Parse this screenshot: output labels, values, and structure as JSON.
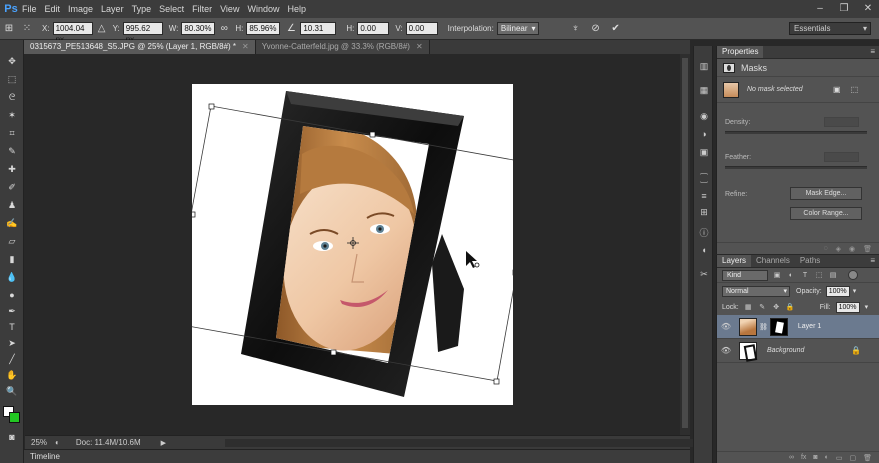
{
  "app": {
    "logo": "Ps"
  },
  "menu": [
    "File",
    "Edit",
    "Image",
    "Layer",
    "Type",
    "Select",
    "Filter",
    "View",
    "Window",
    "Help"
  ],
  "window_controls": {
    "minimize": "–",
    "restore": "❐",
    "close": "✕"
  },
  "options": {
    "x_label": "X:",
    "x_value": "1004.04 px",
    "y_label": "Y:",
    "y_value": "995.62 px",
    "w_label": "W:",
    "w_value": "80.30%",
    "h_label": "H:",
    "h_value": "85.96%",
    "angle_value": "10.31",
    "hskew_label": "H:",
    "hskew_value": "0.00",
    "vskew_label": "V:",
    "vskew_value": "0.00",
    "interp_label": "Interpolation:",
    "interp_value": "Bilinear",
    "workspace": "Essentials"
  },
  "tabs": [
    {
      "label": "0315673_PE513648_S5.JPG @ 25% (Layer 1, RGB/8#) *",
      "active": true
    },
    {
      "label": "Yvonne-Catterfeld.jpg @ 33.3% (RGB/8#)",
      "active": false
    }
  ],
  "status": {
    "zoom": "25%",
    "doc_info": "Doc: 11.4M/10.6M",
    "arrow": "▶"
  },
  "timeline": {
    "label": "Timeline"
  },
  "properties": {
    "tab": "Properties",
    "masks_label": "Masks",
    "no_mask": "No mask selected",
    "density_label": "Density:",
    "feather_label": "Feather:",
    "refine_label": "Refine:",
    "mask_edge_btn": "Mask Edge...",
    "color_range_btn": "Color Range..."
  },
  "layers_panel": {
    "tabs": [
      "Layers",
      "Channels",
      "Paths"
    ],
    "kind_label": "Kind",
    "blend_mode": "Normal",
    "opacity_label": "Opacity:",
    "opacity_value": "100%",
    "lock_label": "Lock:",
    "fill_label": "Fill:",
    "fill_value": "100%",
    "layers": [
      {
        "name": "Layer 1",
        "selected": true
      },
      {
        "name": "Background",
        "selected": false
      }
    ]
  },
  "colors": {
    "foreground": "#ffffff",
    "background": "#22c722",
    "accent": "#4aa3ff"
  }
}
